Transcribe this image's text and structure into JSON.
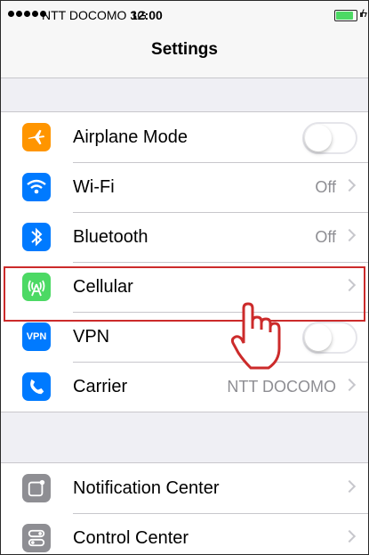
{
  "status_bar": {
    "carrier": "NTT DOCOMO",
    "network": "3G",
    "time": "12:00",
    "battery_level": 0.85,
    "battery_color": "#4cd964"
  },
  "nav": {
    "title": "Settings"
  },
  "settings": [
    {
      "label": "Airplane Mode",
      "icon": "airplane-icon",
      "icon_color": "#ff9500",
      "control": "switch",
      "value": "off"
    },
    {
      "label": "Wi-Fi",
      "icon": "wifi-icon",
      "icon_color": "#007aff",
      "detail": "Off"
    },
    {
      "label": "Bluetooth",
      "icon": "bluetooth-icon",
      "icon_color": "#007aff",
      "detail": "Off"
    },
    {
      "label": "Cellular",
      "icon": "cellular-icon",
      "icon_color": "#4cd964",
      "highlighted": true
    },
    {
      "label": "VPN",
      "icon": "vpn-icon",
      "icon_color": "#007aff",
      "icon_text": "VPN",
      "control": "switch",
      "value": "off"
    },
    {
      "label": "Carrier",
      "icon": "phone-icon",
      "icon_color": "#007aff",
      "detail": "NTT DOCOMO"
    }
  ],
  "settings2": [
    {
      "label": "Notification Center",
      "icon": "notification-icon",
      "icon_color": "#8e8e93"
    },
    {
      "label": "Control Center",
      "icon": "control-center-icon",
      "icon_color": "#8e8e93"
    }
  ],
  "annotation": {
    "highlight_color": "#cc2b2b",
    "pointer": "hand-pointer-icon"
  }
}
